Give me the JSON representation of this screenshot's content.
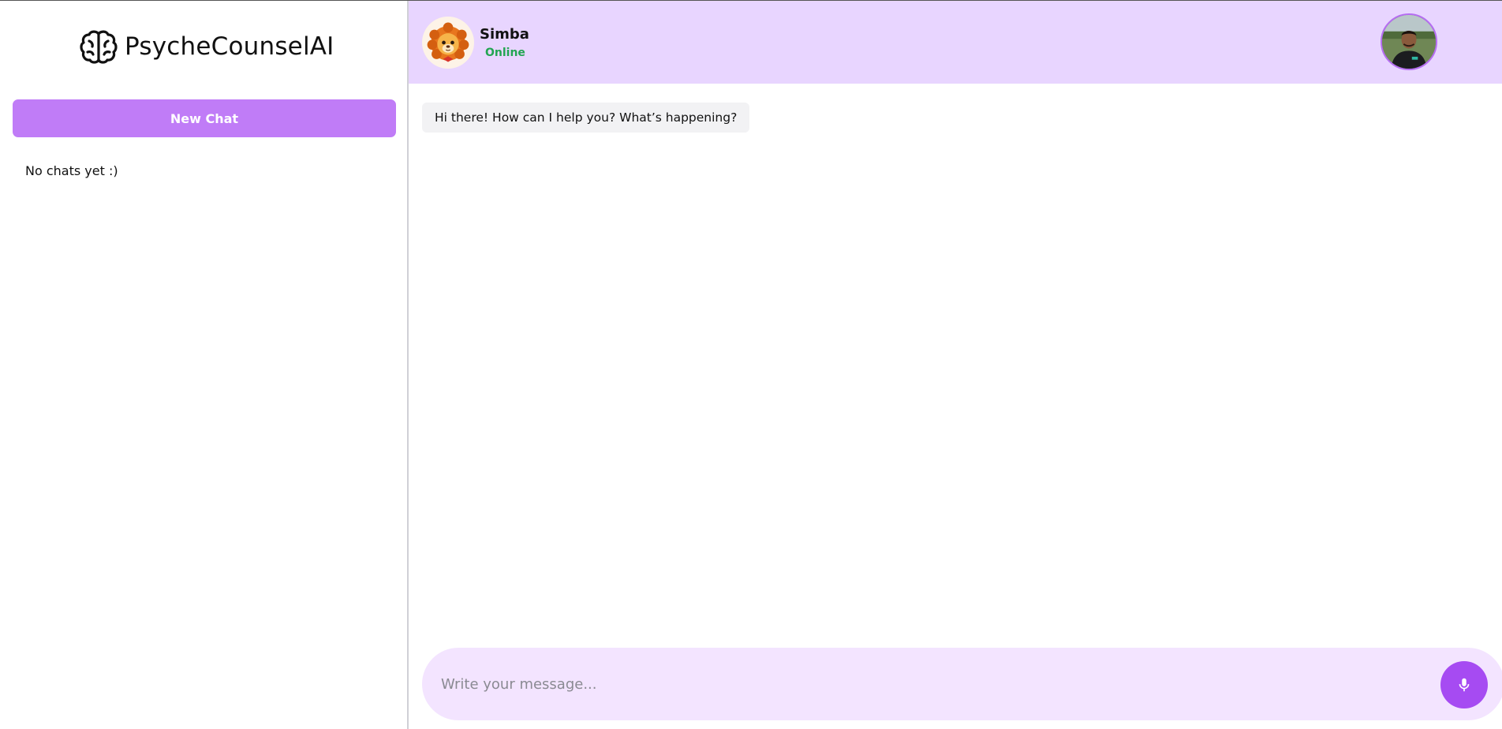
{
  "sidebar": {
    "brand_name": "PsycheCounselAI",
    "new_chat_label": "New Chat",
    "empty_text": "No chats yet :)"
  },
  "header": {
    "bot_name": "Simba",
    "bot_status": "Online"
  },
  "messages": [
    {
      "sender": "bot",
      "text": "Hi there! How can I help you? What’s happening?"
    }
  ],
  "composer": {
    "placeholder": "Write your message...",
    "value": ""
  },
  "colors": {
    "accent": "#c07cf7",
    "header_bg": "#e8d5ff",
    "composer_bg": "#f3e4ff",
    "mic_bg": "#a64bf2",
    "status_online": "#22a552"
  },
  "icons": {
    "brand": "brain-icon",
    "bot_avatar": "lion-avatar",
    "user_avatar": "user-photo-avatar",
    "mic": "microphone-icon"
  }
}
